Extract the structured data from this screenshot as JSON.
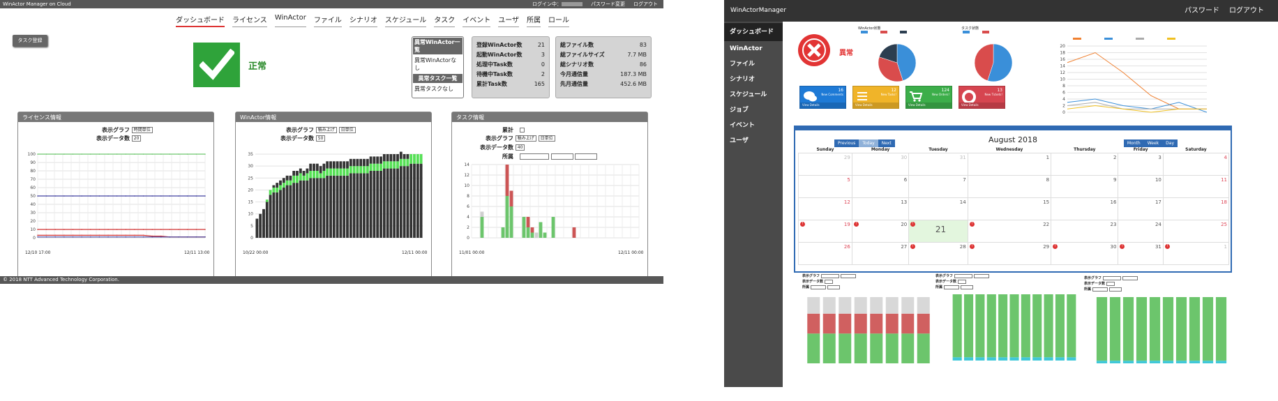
{
  "left": {
    "header": {
      "title": "WinActor Manager on Cloud",
      "login": "ログイン中：",
      "change_pw": "パスワード変更",
      "logout": "ログアウト"
    },
    "nav": [
      "ダッシュボード",
      "ライセンス",
      "WinActor",
      "ファイル",
      "シナリオ",
      "スケジュール",
      "タスク",
      "イベント",
      "ユーザ",
      "所属",
      "ロール"
    ],
    "task_button": "タスク登録",
    "status_text": "正常",
    "abnormal": {
      "wa_header": "異常WinActor一覧",
      "wa_none": "異常WinActorなし",
      "task_header": "異常タスク一覧",
      "task_none": "異常タスクなし"
    },
    "stats1": [
      {
        "label": "登録WinActor数",
        "value": "21"
      },
      {
        "label": "起動WinActor数",
        "value": "3"
      },
      {
        "label": "処理中Task数",
        "value": "0"
      },
      {
        "label": "待機中Task数",
        "value": "2"
      },
      {
        "label": "累計Task数",
        "value": "165"
      }
    ],
    "stats2": [
      {
        "label": "総ファイル数",
        "value": "83"
      },
      {
        "label": "総ファイルサイズ",
        "value": "7.7 MB"
      },
      {
        "label": "総シナリオ数",
        "value": "86"
      },
      {
        "label": "今月通信量",
        "value": "187.3 MB"
      },
      {
        "label": "先月通信量",
        "value": "452.6 MB"
      }
    ],
    "license_panel": {
      "title": "ライセンス情報",
      "graph_label": "表示グラフ",
      "graph_value": "時間単位",
      "count_label": "表示データ数",
      "count_value": "20",
      "x_start": "12/10 17:00",
      "x_end": "12/11 13:00"
    },
    "winactor_panel": {
      "title": "WinActor情報",
      "graph_label": "表示グラフ",
      "graph_value": "積み上げ",
      "unit_value": "日単位",
      "count_label": "表示データ数",
      "count_value": "50",
      "x_start": "10/22 00:00",
      "x_end": "12/11 00:00"
    },
    "task_panel": {
      "title": "タスク情報",
      "cumulative_label": "累計",
      "graph_label": "表示グラフ",
      "graph_value": "積み上げ",
      "unit_value": "日単位",
      "count_label": "表示データ数",
      "count_value": "40",
      "affiliation_label": "所属",
      "x_start": "11/01 00:00",
      "x_end": "12/11 00:00"
    },
    "footer": "© 2018 NTT Advanced Technology Corporation."
  },
  "right": {
    "header": {
      "title": "WinActorManager",
      "password": "パスワード",
      "logout": "ログアウト"
    },
    "sidebar": [
      "ダッシュボード",
      "WinActor",
      "ファイル",
      "シナリオ",
      "スケジュール",
      "ジョブ",
      "イベント",
      "ユーザ"
    ],
    "status_text": "異常",
    "pie1_title": "WinActor状態",
    "pie2_title": "タスク状態",
    "tiles": [
      {
        "num": "16",
        "label": "New Comments",
        "link": "View Details",
        "color": "#1e7ad6",
        "icon": "comments-icon"
      },
      {
        "num": "12",
        "label": "New Tasks!",
        "link": "View Details",
        "color": "#f0b429",
        "icon": "tasks-icon"
      },
      {
        "num": "124",
        "label": "New Orders!",
        "link": "View Details",
        "color": "#3cae4a",
        "icon": "cart-icon"
      },
      {
        "num": "13",
        "label": "New Tickets!",
        "link": "View Details",
        "color": "#d64550",
        "icon": "lifebuoy-icon"
      }
    ],
    "calendar": {
      "title": "August 2018",
      "prev": "Previous",
      "today": "Today",
      "next": "Next",
      "month": "Month",
      "week": "Week",
      "day": "Day",
      "weekdays": [
        "Sunday",
        "Monday",
        "Tuesday",
        "Wednesday",
        "Thursday",
        "Friday",
        "Saturday"
      ],
      "weeks": [
        [
          "29",
          "30",
          "31",
          "1",
          "2",
          "3",
          "4"
        ],
        [
          "5",
          "6",
          "7",
          "8",
          "9",
          "10",
          "11"
        ],
        [
          "12",
          "13",
          "14",
          "15",
          "16",
          "17",
          "18"
        ],
        [
          "19",
          "20",
          "21",
          "22",
          "23",
          "24",
          "25"
        ],
        [
          "26",
          "27",
          "28",
          "29",
          "30",
          "31",
          "1"
        ]
      ]
    },
    "bottom_controls": {
      "graph_label": "表示グラフ",
      "count_label": "表示データ数",
      "aff_label": "所属"
    }
  },
  "chart_data": [
    {
      "type": "line",
      "title": "ライセンス情報",
      "x": [
        "12/10 17:00",
        "12/11 13:00"
      ],
      "ylim": [
        0,
        100
      ],
      "yticks": [
        0,
        10,
        20,
        30,
        40,
        50,
        60,
        70,
        80,
        90,
        100
      ],
      "series": [
        {
          "color": "#6cc56c",
          "values": [
            100,
            100,
            100,
            100,
            100,
            100,
            100,
            100,
            100,
            100,
            100,
            100,
            100,
            100,
            100,
            100,
            100,
            100,
            100,
            100
          ]
        },
        {
          "color": "#4040a0",
          "values": [
            50,
            50,
            50,
            50,
            50,
            50,
            50,
            50,
            50,
            50,
            50,
            50,
            50,
            50,
            50,
            50,
            50,
            50,
            50,
            50
          ]
        },
        {
          "color": "#d03030",
          "values": [
            10,
            10,
            10,
            10,
            10,
            10,
            10,
            10,
            10,
            10,
            10,
            10,
            10,
            10,
            10,
            10,
            10,
            10,
            10,
            10
          ]
        },
        {
          "color": "#d03030",
          "values": [
            3,
            3,
            3,
            3,
            3,
            3,
            3,
            3,
            3,
            3,
            3,
            3,
            3,
            2,
            2,
            1,
            1,
            1,
            1,
            1
          ]
        },
        {
          "color": "#4040a0",
          "values": [
            1,
            1,
            1,
            1,
            1,
            1,
            1,
            1,
            1,
            1,
            1,
            1,
            1,
            1,
            1,
            1,
            1,
            1,
            1,
            1
          ]
        }
      ]
    },
    {
      "type": "bar",
      "title": "WinActor情報",
      "stacked": true,
      "ylim": [
        0,
        35
      ],
      "yticks": [
        0,
        5,
        10,
        15,
        20,
        25,
        30,
        35
      ],
      "x_labels": [
        "10/22 00:00",
        "12/11 00:00"
      ],
      "series": [
        {
          "color": "#333333",
          "values": [
            8,
            10,
            12,
            15,
            18,
            19,
            19,
            20,
            21,
            22,
            22,
            23,
            23,
            24,
            24,
            24,
            25,
            25,
            25,
            25,
            25,
            26,
            26,
            26,
            26,
            26,
            26,
            26,
            27,
            27,
            27,
            27,
            27,
            27,
            28,
            28,
            28,
            28,
            29,
            29,
            29,
            29,
            29,
            30,
            30,
            30,
            31,
            31,
            31,
            31
          ]
        },
        {
          "color": "#55e055",
          "values": [
            0,
            0,
            0,
            1,
            2,
            2,
            2,
            2,
            2,
            2,
            2,
            3,
            3,
            3,
            2,
            3,
            3,
            3,
            3,
            2,
            3,
            3,
            3,
            3,
            3,
            3,
            3,
            3,
            3,
            3,
            3,
            3,
            3,
            3,
            3,
            3,
            3,
            3,
            3,
            3,
            3,
            3,
            3,
            3,
            3,
            3,
            4,
            4,
            4,
            4
          ]
        },
        {
          "color": "#333333",
          "values": [
            0,
            0,
            0,
            0,
            0,
            1,
            2,
            2,
            2,
            2,
            2,
            2,
            2,
            2,
            2,
            2,
            3,
            3,
            3,
            3,
            3,
            3,
            3,
            3,
            3,
            3,
            3,
            3,
            3,
            3,
            3,
            3,
            3,
            3,
            3,
            3,
            3,
            3,
            3,
            3,
            3,
            3,
            3,
            3,
            2,
            2,
            0,
            0,
            0,
            0
          ]
        }
      ]
    },
    {
      "type": "bar",
      "title": "タスク情報",
      "stacked": true,
      "ylim": [
        0,
        14
      ],
      "yticks": [
        0,
        2,
        4,
        6,
        8,
        10,
        12,
        14
      ],
      "x_labels": [
        "11/01 00:00",
        "12/11 00:00"
      ],
      "series": [
        {
          "name": "",
          "color": "#6cc56c",
          "values": [
            0,
            0,
            4,
            0,
            0,
            0,
            0,
            2,
            8,
            6,
            0,
            0,
            4,
            2,
            1,
            0,
            3,
            1,
            0,
            4,
            0,
            0,
            0,
            0,
            0,
            0,
            0,
            0,
            0,
            0,
            0,
            0,
            0,
            0,
            0,
            0,
            0,
            0,
            0,
            0
          ]
        },
        {
          "name": "",
          "color": "#cc5555",
          "values": [
            0,
            0,
            0,
            0,
            0,
            0,
            0,
            0,
            6,
            3,
            0,
            0,
            0,
            2,
            1,
            0,
            0,
            0,
            0,
            0,
            0,
            0,
            0,
            0,
            0,
            0,
            0,
            0,
            0,
            0,
            0,
            0,
            0,
            0,
            0,
            0,
            0,
            0,
            0,
            0
          ]
        },
        {
          "name": "",
          "color": "#cfcfcf",
          "values": [
            0,
            0,
            1,
            0,
            0,
            0,
            0,
            0,
            0,
            0,
            0,
            0,
            0,
            0,
            0,
            1,
            0,
            0,
            0,
            0,
            0,
            0,
            0,
            0,
            0,
            0,
            0,
            0,
            0,
            0,
            0,
            0,
            0,
            0,
            0,
            0,
            0,
            0,
            0,
            0
          ]
        },
        {
          "name": "",
          "color": "#cc5555",
          "values": [
            0,
            0,
            0,
            0,
            0,
            0,
            0,
            0,
            0,
            0,
            0,
            0,
            0,
            0,
            0,
            0,
            0,
            0,
            0,
            0,
            0,
            0,
            0,
            0,
            2,
            0,
            0,
            0,
            0,
            0,
            0,
            0,
            0,
            0,
            0,
            0,
            0,
            0,
            0,
            0
          ]
        }
      ]
    },
    {
      "type": "pie",
      "title": "WinActor状態",
      "values": [
        45,
        35,
        20
      ],
      "colors": [
        "#3a8fd9",
        "#d94c4c",
        "#2c3e50"
      ]
    },
    {
      "type": "pie",
      "title": "タスク状態",
      "values": [
        55,
        45
      ],
      "colors": [
        "#3a8fd9",
        "#d94c4c"
      ]
    },
    {
      "type": "line",
      "title": "",
      "ylim": [
        0,
        20
      ],
      "yticks": [
        0,
        2,
        4,
        6,
        8,
        10,
        12,
        14,
        16,
        18,
        20
      ],
      "series": [
        {
          "color": "#f08030",
          "values": [
            15,
            18,
            12,
            5,
            1,
            1
          ]
        },
        {
          "color": "#3a8fd9",
          "values": [
            3,
            4,
            2,
            1,
            3,
            0
          ]
        },
        {
          "color": "#aaaaaa",
          "values": [
            2,
            3,
            1,
            1,
            1,
            1
          ]
        },
        {
          "color": "#f0c020",
          "values": [
            1,
            2,
            1,
            0,
            1,
            1
          ]
        }
      ]
    },
    {
      "type": "bar",
      "stacked": true,
      "title": "",
      "series": [
        {
          "color": "#6cc56c",
          "values": [
            45,
            45,
            45,
            45,
            45,
            45,
            45,
            45
          ]
        },
        {
          "color": "#d06060",
          "values": [
            30,
            30,
            30,
            30,
            30,
            30,
            30,
            30
          ]
        },
        {
          "color": "#d8d8d8",
          "values": [
            25,
            25,
            25,
            25,
            25,
            25,
            25,
            25
          ]
        }
      ]
    },
    {
      "type": "bar",
      "stacked": true,
      "title": "",
      "series": [
        {
          "color": "#40c8d8",
          "values": [
            5,
            5,
            5,
            5,
            5,
            5,
            5,
            5,
            5,
            5,
            5
          ]
        },
        {
          "color": "#6cc56c",
          "values": [
            95,
            95,
            95,
            95,
            95,
            95,
            95,
            95,
            95,
            95,
            95
          ]
        }
      ]
    },
    {
      "type": "bar",
      "stacked": true,
      "title": "",
      "series": [
        {
          "color": "#40c8d8",
          "values": [
            4,
            4,
            4,
            4,
            4,
            4,
            4,
            4,
            4,
            4
          ]
        },
        {
          "color": "#6cc56c",
          "values": [
            96,
            96,
            96,
            96,
            96,
            96,
            96,
            96,
            96,
            96
          ]
        }
      ]
    }
  ]
}
